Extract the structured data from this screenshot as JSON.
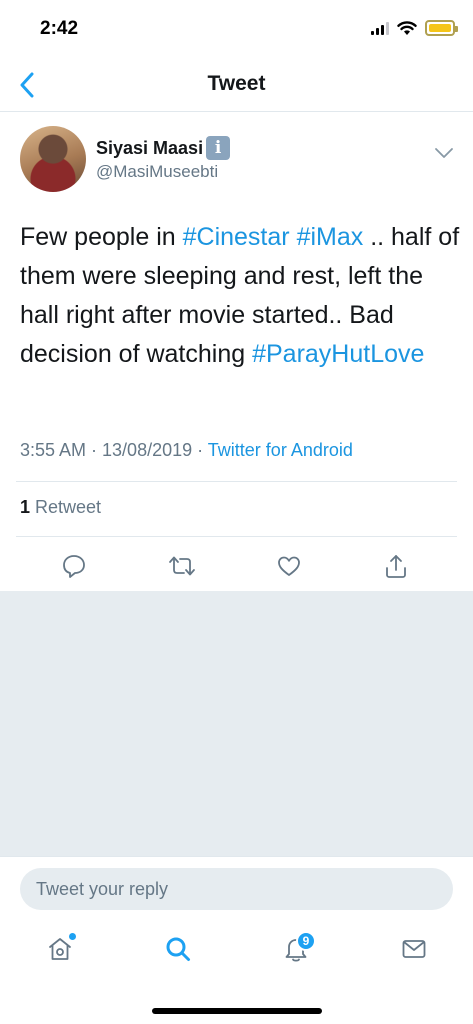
{
  "status_bar": {
    "time": "2:42"
  },
  "nav": {
    "title": "Tweet",
    "back_icon": "chevron-left-icon"
  },
  "tweet": {
    "author": {
      "display_name": "Siyasi Maasi",
      "badge_text": "i",
      "handle": "@MasiMuseebti"
    },
    "text_parts": {
      "p1": "Few people in ",
      "tag1": "#Cinestar",
      "p2": " ",
      "tag2": "#iMax",
      "p3": " .. half of them were sleeping and rest, left the hall right after movie started.. Bad decision of watching ",
      "tag3": "#ParayHutLove"
    },
    "timestamp": "3:55 AM · 13/08/2019 · ",
    "source": "Twitter for Android",
    "retweet_count": "1",
    "retweet_label": " Retweet"
  },
  "actions": [
    "reply-icon",
    "retweet-icon",
    "like-icon",
    "share-icon"
  ],
  "reply": {
    "placeholder": "Tweet your reply"
  },
  "tabbar": {
    "items": [
      "home-icon",
      "search-icon",
      "notifications-icon",
      "messages-icon"
    ],
    "notification_count": "9"
  },
  "colors": {
    "accent": "#1da1f2",
    "link": "#1b95e0",
    "muted": "#657786",
    "background_gray": "#e6ecf0"
  }
}
